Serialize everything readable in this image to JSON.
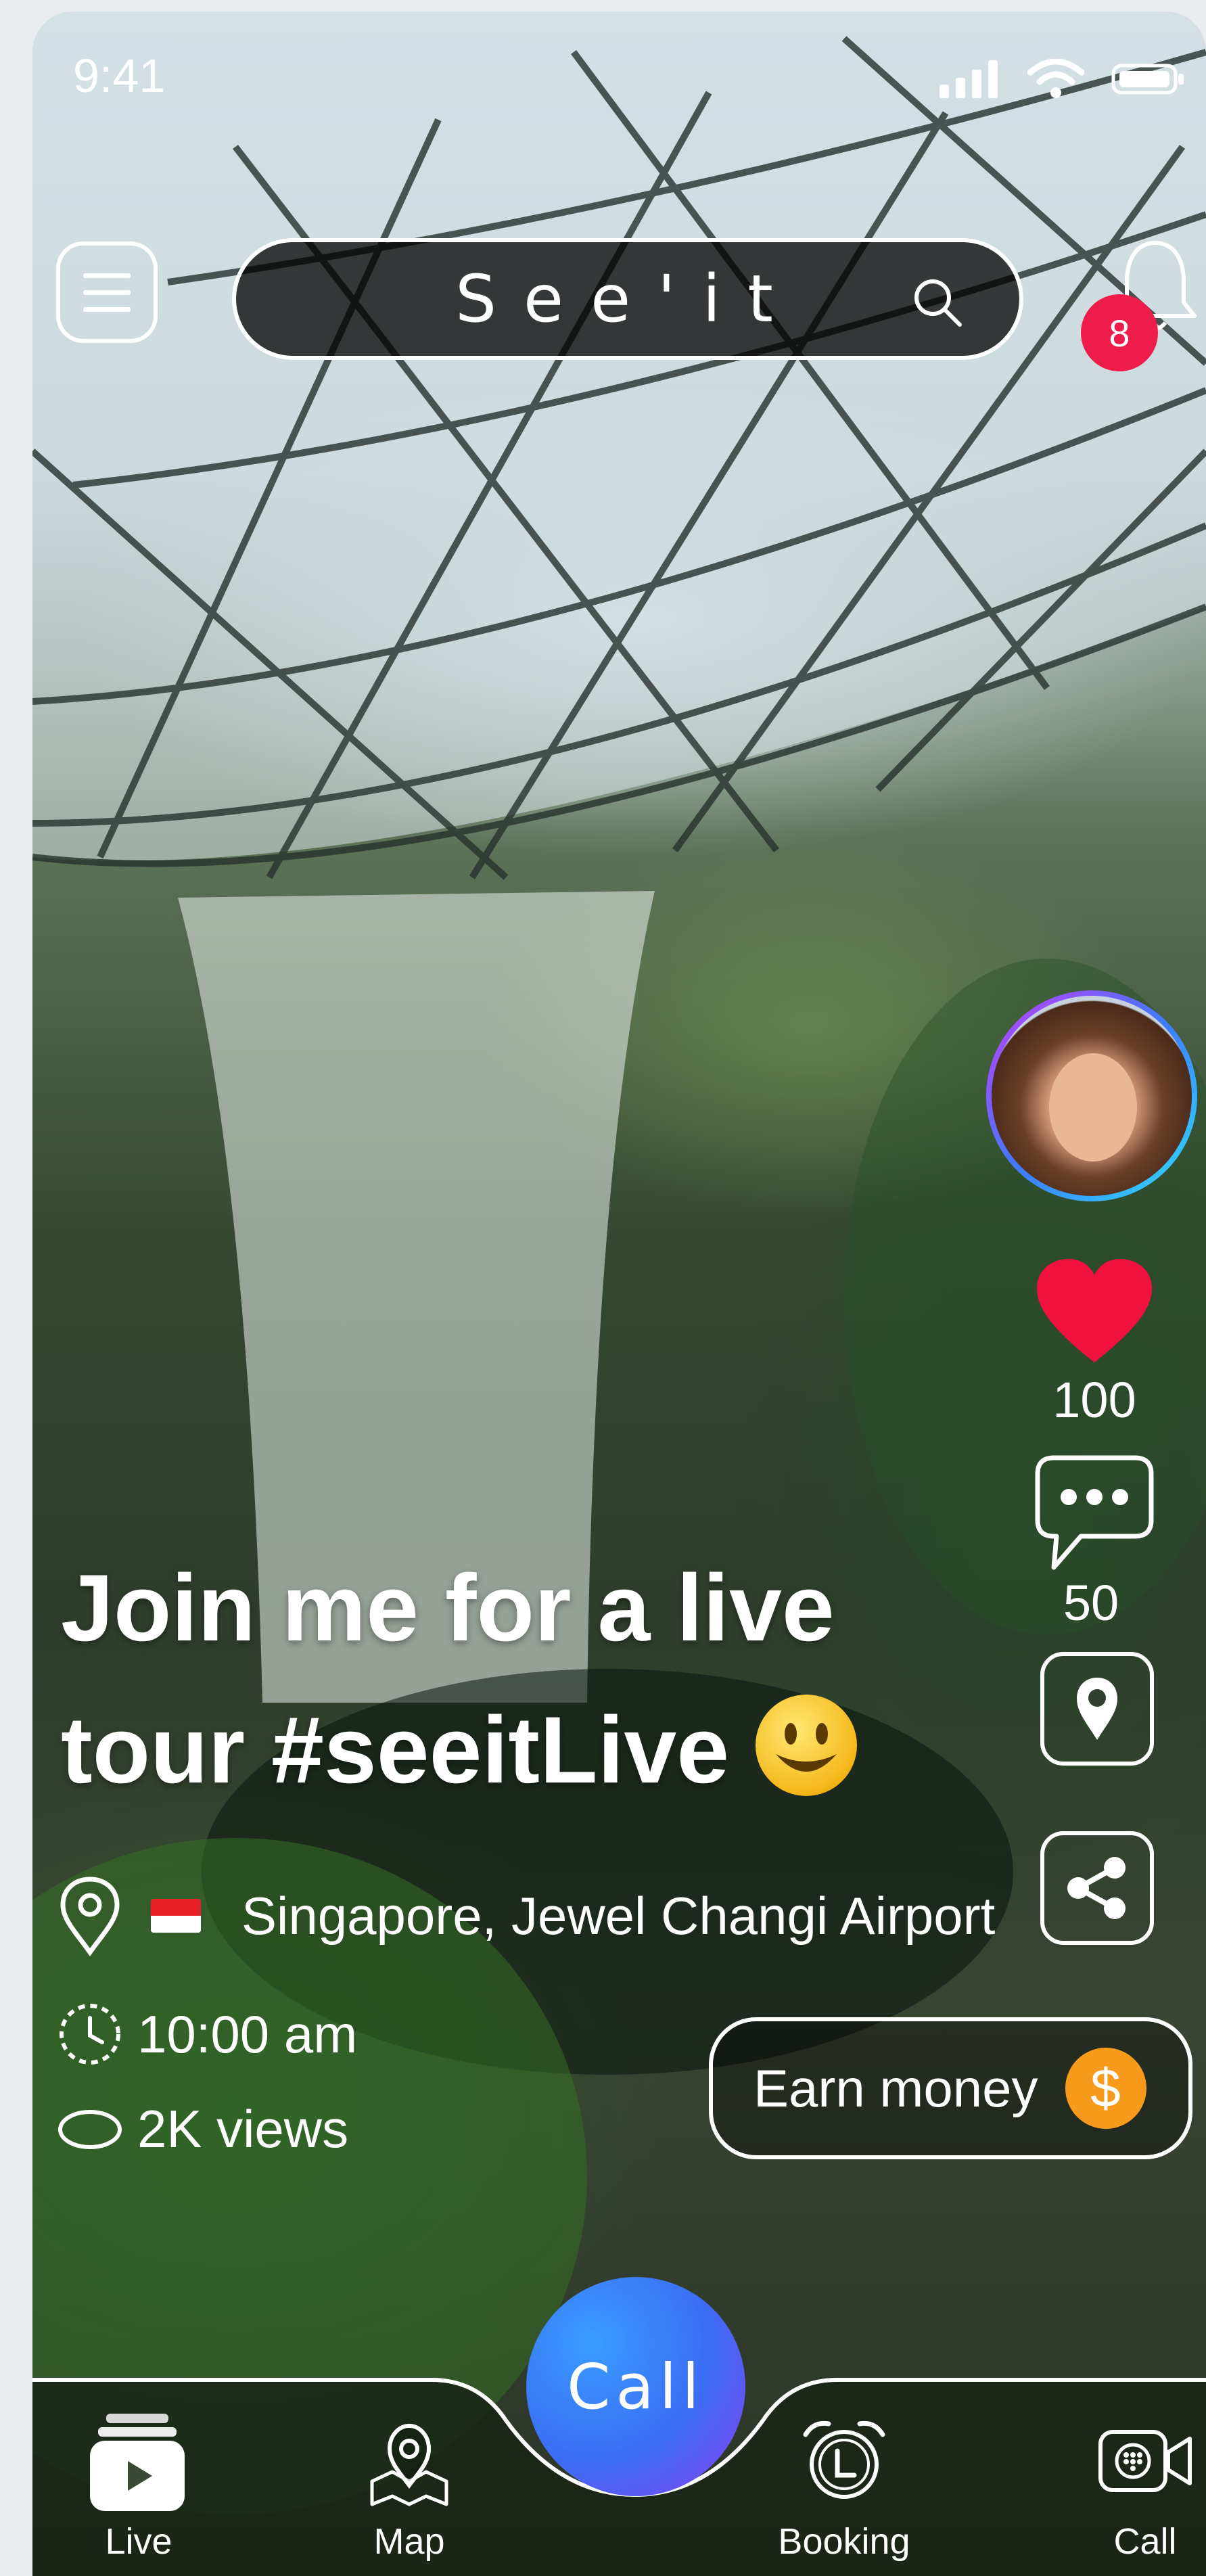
{
  "status_bar": {
    "time": "9:41"
  },
  "header": {
    "logo": "See'it",
    "notification_count": "8"
  },
  "post": {
    "caption_line1": "Join me for a live",
    "caption_line2": "tour  #seeitLive",
    "location": "Singapore, Jewel Changi Airport",
    "time": "10:00 am",
    "views": "2K views"
  },
  "actions": {
    "likes": "100",
    "comments": "50",
    "earn_money_label": "Earn money",
    "coin_symbol": "$"
  },
  "bottom_nav": {
    "items": [
      {
        "label": "Live",
        "icon": "play-icon",
        "active": true
      },
      {
        "label": "Map",
        "icon": "map-pin-icon",
        "active": false
      },
      {
        "label": "Booking",
        "icon": "alarm-clock-icon",
        "active": false
      },
      {
        "label": "Call",
        "icon": "video-call-icon",
        "active": false
      }
    ],
    "call_button": "Call"
  },
  "colors": {
    "badge": "#ee1c4a",
    "heart": "#f0113f",
    "coin": "#f89a1c",
    "call_button": "#3b6df5"
  }
}
